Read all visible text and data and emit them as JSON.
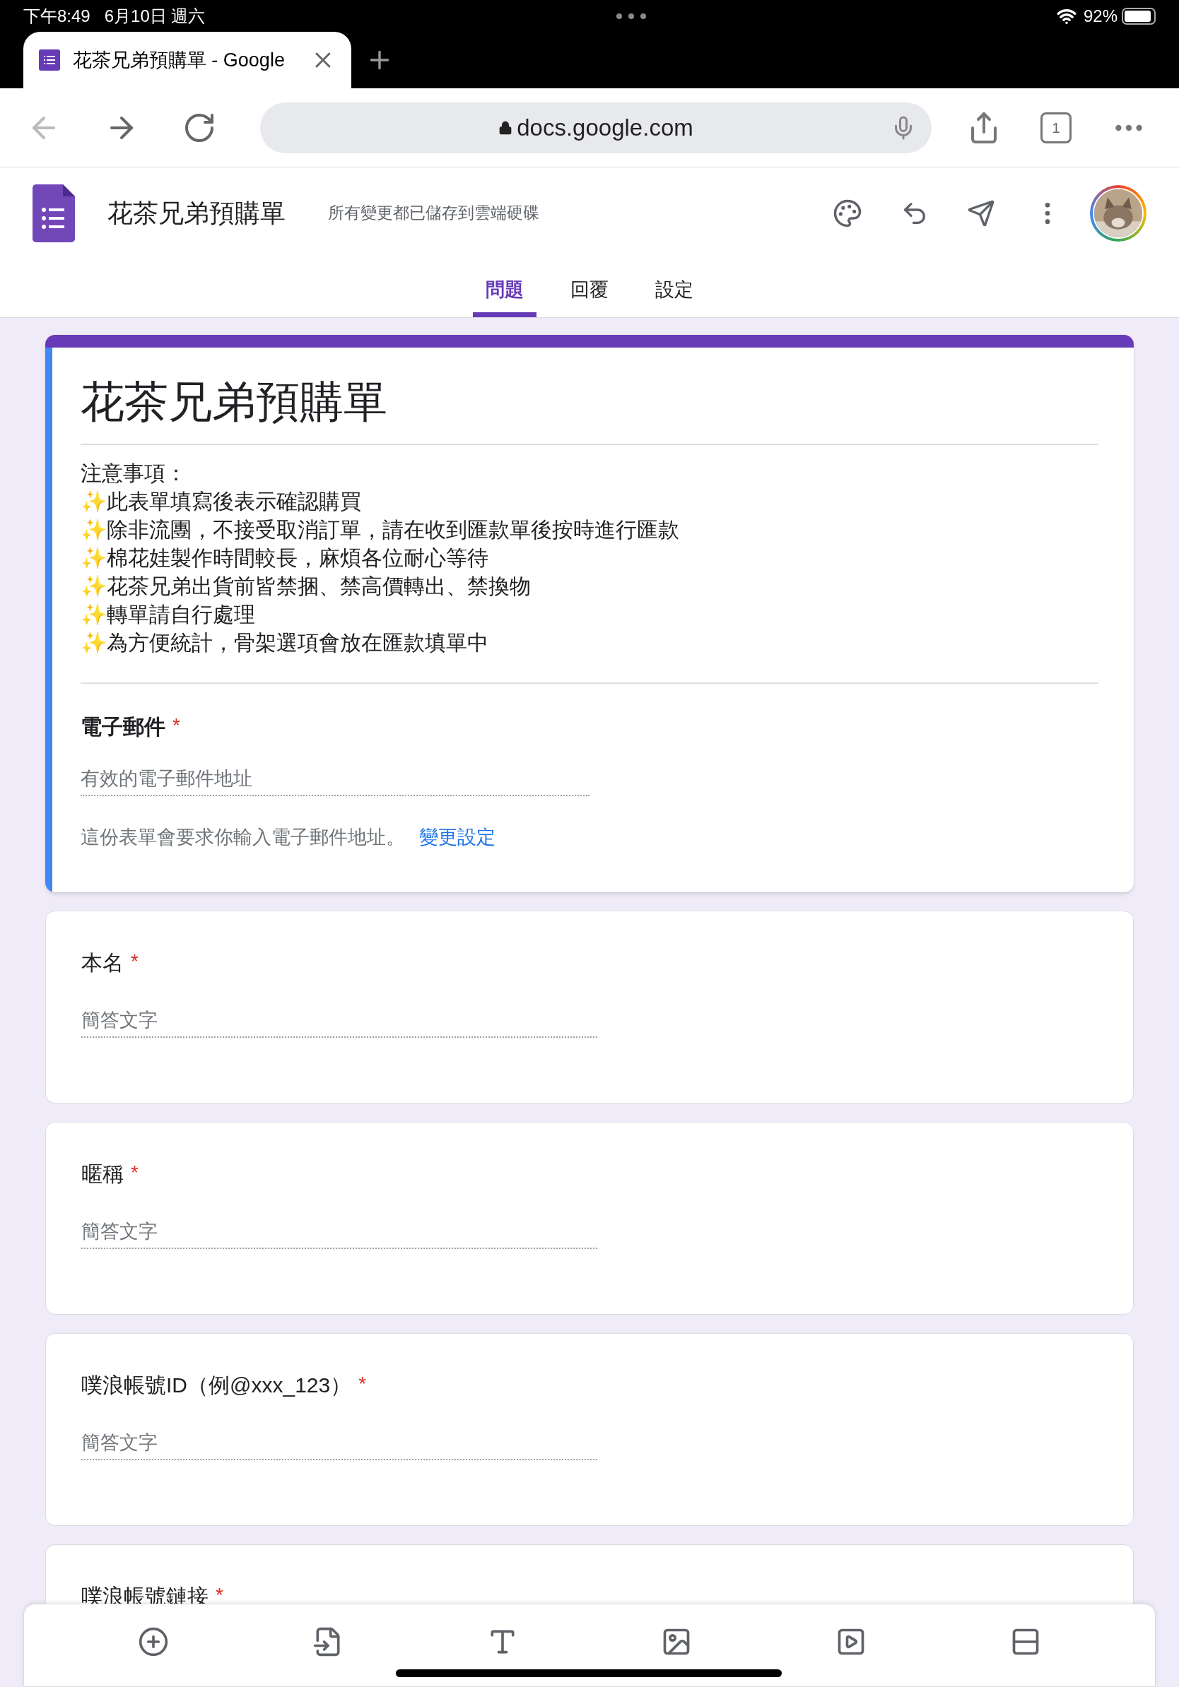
{
  "status_bar": {
    "time": "下午8:49",
    "date": "6月10日 週六",
    "battery": "92%"
  },
  "browser": {
    "tab": {
      "title": "花茶兄弟預購單 - Google",
      "selected": true
    },
    "url": "docs.google.com",
    "tab_count": "1"
  },
  "app_header": {
    "title": "花茶兄弟預購單",
    "save_status": "所有變更都已儲存到雲端硬碟"
  },
  "tabs": [
    {
      "label": "問題",
      "selected": true
    },
    {
      "label": "回覆",
      "selected": false
    },
    {
      "label": "設定",
      "selected": false
    }
  ],
  "form": {
    "title": "花茶兄弟預購單",
    "description": [
      "注意事項：",
      "✨此表單填寫後表示確認購買",
      "✨除非流團，不接受取消訂單，請在收到匯款單後按時進行匯款",
      "✨棉花娃製作時間較長，麻煩各位耐心等待",
      "✨花茶兄弟出貨前皆禁捆、禁高價轉出、禁換物",
      "✨轉單請自行處理",
      "✨為方便統計，骨架選項會放在匯款填單中"
    ],
    "email_question": {
      "label": "電子郵件",
      "required_mark": "*",
      "placeholder": "有效的電子郵件地址",
      "note": "這份表單會要求你輸入電子郵件地址。",
      "link": "變更設定"
    }
  },
  "questions": [
    {
      "label": "本名",
      "required_mark": "*",
      "placeholder": "簡答文字"
    },
    {
      "label": "暱稱",
      "required_mark": "*",
      "placeholder": "簡答文字"
    },
    {
      "label": "噗浪帳號ID（例@xxx_123）",
      "required_mark": "*",
      "placeholder": "簡答文字"
    },
    {
      "label": "噗浪帳號鏈接",
      "required_mark": "*"
    }
  ]
}
